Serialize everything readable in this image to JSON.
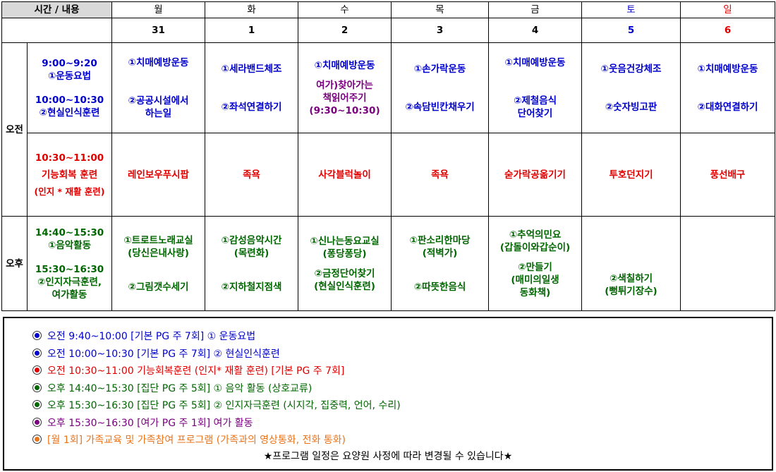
{
  "header": {
    "time_label": "시간 / 내용",
    "days": [
      "월",
      "화",
      "수",
      "목",
      "금",
      "토",
      "일"
    ],
    "dates": [
      "31",
      "1",
      "2",
      "3",
      "4",
      "5",
      "6"
    ]
  },
  "periods": {
    "am": "오전",
    "pm": "오후"
  },
  "am1": {
    "time_lines": [
      "9:00~9:20",
      "①운동요법",
      "10:00~10:30",
      "②현실인식훈련"
    ],
    "cells": [
      {
        "a": [
          "①치매예방운동"
        ],
        "b": [
          "②공공시설에서",
          "하는일"
        ]
      },
      {
        "a": [
          "①세라밴드체조"
        ],
        "b": [
          "②좌석연결하기"
        ]
      },
      {
        "a": [
          "①치매예방운동"
        ],
        "b": [
          "여가)찾아가는",
          "책읽어주기",
          "(9:30~10:30)"
        ]
      },
      {
        "a": [
          "①손가락운동"
        ],
        "b": [
          "②속담빈칸채우기"
        ]
      },
      {
        "a": [
          "①치매예방운동"
        ],
        "b": [
          "②제철음식",
          "단어찾기"
        ]
      },
      {
        "a": [
          "①웃음건강체조"
        ],
        "b": [
          "②숫자빙고판"
        ]
      },
      {
        "a": [
          "①치매예방운동"
        ],
        "b": [
          "②대화연결하기"
        ]
      }
    ]
  },
  "am2": {
    "time_lines": [
      "10:30~11:00",
      "기능회복 훈련",
      "(인지 * 재활 훈련)"
    ],
    "cells": [
      "레인보우푸시팝",
      "족욕",
      "사각블럭놀이",
      "족욕",
      "숟가락공옮기기",
      "투호던지기",
      "풍선배구"
    ]
  },
  "pm": {
    "time_lines": [
      "14:40~15:30",
      "①음악활동",
      "15:30~16:30",
      "②인지자극훈련,",
      "여가활동"
    ],
    "cells": [
      {
        "a": [
          "①트로트노래교실",
          "(당신은내사랑)"
        ],
        "b": [
          "②그림갯수세기"
        ]
      },
      {
        "a": [
          "①감성음악시간",
          "(목련화)"
        ],
        "b": [
          "②지하철지점색"
        ]
      },
      {
        "a": [
          "①신나는동요교실",
          "(퐁당퐁당)"
        ],
        "b": [
          "②금정단어찾기",
          "(현실인식훈련)"
        ]
      },
      {
        "a": [
          "①판소리한마당",
          "(적벽가)"
        ],
        "b": [
          "②따뜻한음식"
        ]
      },
      {
        "a": [
          "①추억의민요",
          "(갑돌이와갑순이)"
        ],
        "b": [
          "②만들기",
          "(매미의일생",
          "동화책)"
        ]
      },
      {
        "a": [],
        "b": [
          "②색칠하기",
          "(뻥튀기장수)"
        ]
      },
      {
        "a": [],
        "b": []
      }
    ]
  },
  "legend": [
    {
      "color": "#0000cc",
      "text": "오전 9:40~10:00 [기본 PG 주 7회] ① 운동요법"
    },
    {
      "color": "#0000cc",
      "text": "오전 10:00~10:30 [기본 PG 주 7회] ② 현실인식훈련"
    },
    {
      "color": "#e00000",
      "text": "오전 10:30~11:00 기능회복훈련 (인지* 재활 훈련) [기본 PG 주 7회]"
    },
    {
      "color": "#006600",
      "text": "오후 14:40~15:30 [집단 PG 주 5회] ① 음악 활동 (상호교류)"
    },
    {
      "color": "#006600",
      "text": "오후 15:30~16:30 [집단 PG 주 5회] ② 인지자극훈련 (시지각, 집중력, 언어, 수리)"
    },
    {
      "color": "#7a0080",
      "text": "오후 15:30~16:30 [여가 PG 주 1회]  여가 활동"
    },
    {
      "color": "#e8731a",
      "text": "[월 1회] 가족교육 및 가족참여 프로그램 (가족과의 영상통화, 전화 통화)"
    }
  ],
  "note": "★프로그램 일정은 요양원 사정에 따라 변경될 수 있습니다★"
}
